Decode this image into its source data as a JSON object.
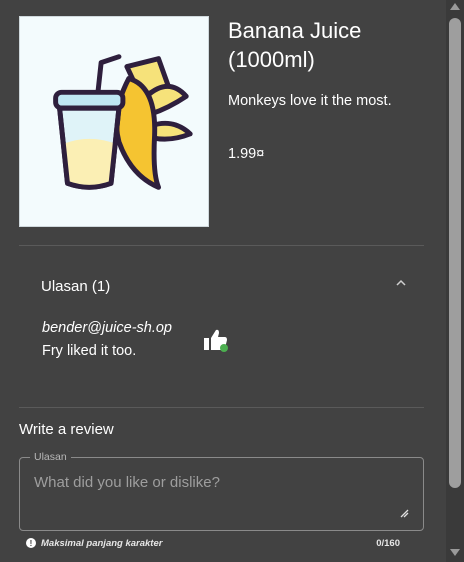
{
  "product": {
    "name": "Banana Juice (1000ml)",
    "description": "Monkeys love it the most.",
    "price": "1.99¤",
    "image_icon": "banana-juice-icon"
  },
  "reviews": {
    "header": "Ulasan (1)",
    "expanded": true,
    "items": [
      {
        "author": "bender@juice-sh.op",
        "text": "Fry liked it too."
      }
    ]
  },
  "write_review": {
    "title": "Write a review",
    "field_label": "Ulasan",
    "placeholder": "What did you like or dislike?",
    "value": "",
    "hint": "Maksimal panjang karakter",
    "counter": "0/160"
  },
  "colors": {
    "background": "#424242",
    "like_badge": "#4caf50"
  }
}
